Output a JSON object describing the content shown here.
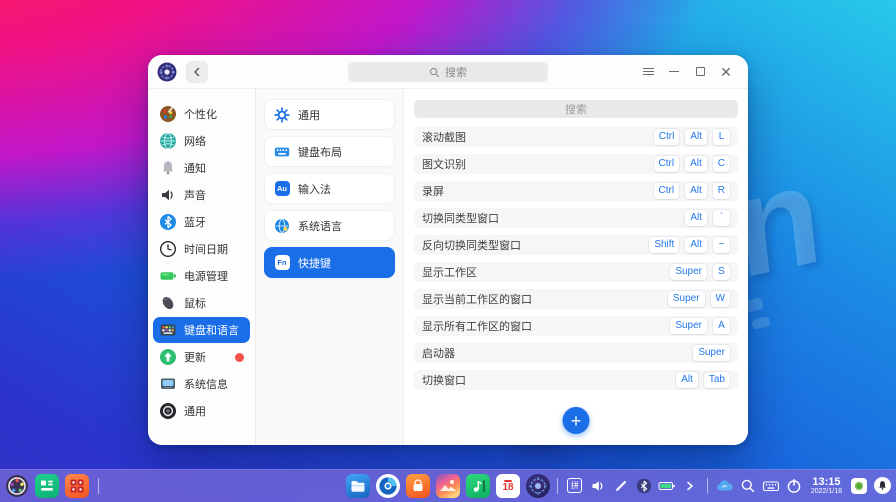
{
  "colors": {
    "accent": "#1a6ee8",
    "key_text": "#2277e8",
    "badge_red": "#f4504b",
    "taskbar": "rgba(118,106,216,0.78)"
  },
  "wallpaper": {
    "watermark_letter": "n"
  },
  "titlebar": {
    "search_placeholder": "搜索"
  },
  "sidebar": {
    "items": [
      {
        "label": "个性化",
        "icon": "palette-icon"
      },
      {
        "label": "网络",
        "icon": "globe-icon"
      },
      {
        "label": "通知",
        "icon": "bell-icon"
      },
      {
        "label": "声音",
        "icon": "speaker-icon"
      },
      {
        "label": "蓝牙",
        "icon": "bluetooth-icon"
      },
      {
        "label": "时间日期",
        "icon": "clock-icon"
      },
      {
        "label": "电源管理",
        "icon": "battery-icon"
      },
      {
        "label": "鼠标",
        "icon": "mouse-icon"
      },
      {
        "label": "键盘和语言",
        "icon": "keyboard-icon",
        "selected": true
      },
      {
        "label": "更新",
        "icon": "update-icon",
        "badge": true
      },
      {
        "label": "系统信息",
        "icon": "monitor-icon"
      },
      {
        "label": "通用",
        "icon": "dial-icon"
      }
    ]
  },
  "middle": {
    "items": [
      {
        "label": "通用",
        "icon": "gear-icon"
      },
      {
        "label": "键盘布局",
        "icon": "keyboard-layout-icon"
      },
      {
        "label": "输入法",
        "icon": "input-method-icon",
        "icon_text": "Au"
      },
      {
        "label": "系统语言",
        "icon": "language-globe-icon"
      },
      {
        "label": "快捷键",
        "icon": "fn-key-icon",
        "icon_text": "Fn",
        "selected": true
      }
    ]
  },
  "content": {
    "search_placeholder": "搜索",
    "shortcuts": [
      {
        "label": "滚动截图",
        "keys": [
          "Ctrl",
          "Alt",
          "L"
        ]
      },
      {
        "label": "图文识别",
        "keys": [
          "Ctrl",
          "Alt",
          "C"
        ]
      },
      {
        "label": "录屏",
        "keys": [
          "Ctrl",
          "Alt",
          "R"
        ]
      },
      {
        "label": "切换同类型窗口",
        "keys": [
          "Alt",
          "`"
        ]
      },
      {
        "label": "反向切换同类型窗口",
        "keys": [
          "Shift",
          "Alt",
          "~"
        ]
      },
      {
        "label": "显示工作区",
        "keys": [
          "Super",
          "S"
        ]
      },
      {
        "label": "显示当前工作区的窗口",
        "keys": [
          "Super",
          "W"
        ]
      },
      {
        "label": "显示所有工作区的窗口",
        "keys": [
          "Super",
          "A"
        ]
      },
      {
        "label": "启动器",
        "keys": [
          "Super"
        ]
      },
      {
        "label": "切换窗口",
        "keys": [
          "Alt",
          "Tab"
        ]
      }
    ],
    "add_button": "+"
  },
  "taskbar": {
    "input_method_label": "拼",
    "calendar_day": "18",
    "clock": {
      "time": "13:15",
      "date": "2022/1/18"
    }
  }
}
